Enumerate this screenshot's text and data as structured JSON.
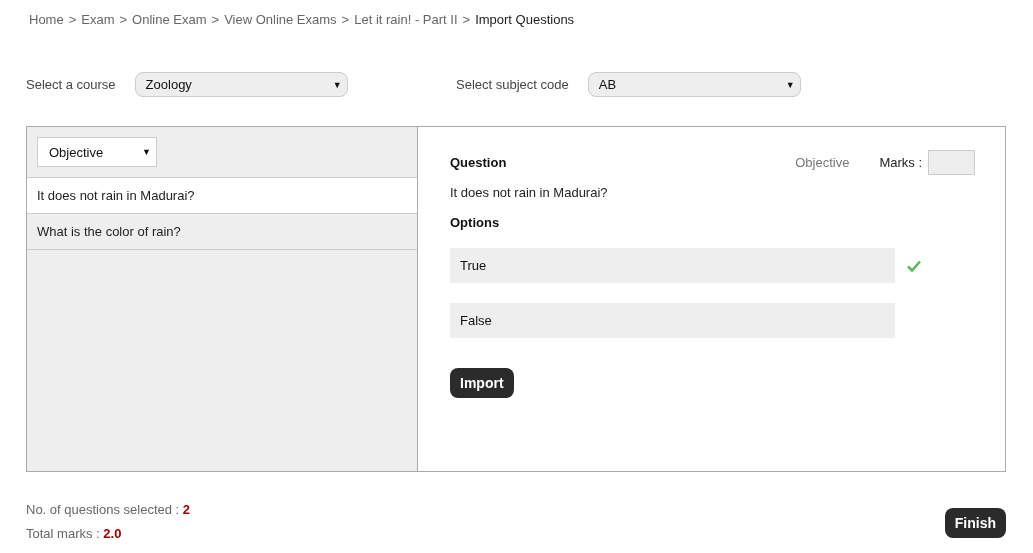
{
  "breadcrumb": {
    "separator": ">",
    "items": [
      {
        "label": "Home",
        "current": false
      },
      {
        "label": "Exam",
        "current": false
      },
      {
        "label": "Online Exam",
        "current": false
      },
      {
        "label": "View Online Exams",
        "current": false
      },
      {
        "label": "Let it rain! - Part II",
        "current": false
      },
      {
        "label": "Import Questions",
        "current": true
      }
    ]
  },
  "filters": [
    {
      "label": "Select a course",
      "value": "Zoology",
      "arrow": "▼"
    },
    {
      "label": "Select subject code",
      "value": "AB",
      "arrow": "▼"
    }
  ],
  "question_list": {
    "type_filter": {
      "value": "Objective",
      "arrow": "▼"
    },
    "items": [
      {
        "text": "It does not rain in Madurai?",
        "selected": true
      },
      {
        "text": "What is the color of rain?",
        "selected": false
      }
    ]
  },
  "detail": {
    "heading": "Question",
    "type": "Objective",
    "marks_label": "Marks :",
    "question": "It does not rain in Madurai?",
    "options_heading": "Options",
    "options": [
      {
        "text": "True",
        "correct": true
      },
      {
        "text": "False",
        "correct": false
      }
    ],
    "import_button": "Import"
  },
  "summary": {
    "selected_label": "No. of questions selected :",
    "selected_count": "2",
    "marks_label": "Total marks :",
    "total_marks": "2.0"
  },
  "finish_button": "Finish"
}
